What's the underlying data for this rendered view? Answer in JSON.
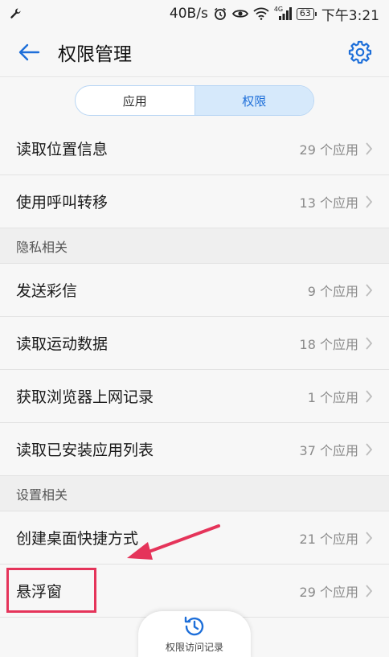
{
  "status_bar": {
    "speed": "40B/s",
    "network": "4G",
    "battery": "63",
    "time": "下午3:21"
  },
  "header": {
    "title": "权限管理"
  },
  "tabs": [
    {
      "label": "应用",
      "active": false
    },
    {
      "label": "权限",
      "active": true
    }
  ],
  "top_items": [
    {
      "label": "读取位置信息",
      "count": "29 个应用"
    },
    {
      "label": "使用呼叫转移",
      "count": "13 个应用"
    }
  ],
  "sections": [
    {
      "title": "隐私相关",
      "items": [
        {
          "label": "发送彩信",
          "count": "9 个应用"
        },
        {
          "label": "读取运动数据",
          "count": "18 个应用"
        },
        {
          "label": "获取浏览器上网记录",
          "count": "1 个应用"
        },
        {
          "label": "读取已安装应用列表",
          "count": "37 个应用"
        }
      ]
    },
    {
      "title": "设置相关",
      "items": [
        {
          "label": "创建桌面快捷方式",
          "count": "21 个应用"
        },
        {
          "label": "悬浮窗",
          "count": "29 个应用"
        }
      ]
    }
  ],
  "bottom_button": {
    "label": "权限访问记录"
  },
  "colors": {
    "accent": "#1e6fd9",
    "highlight": "#e5345a"
  }
}
